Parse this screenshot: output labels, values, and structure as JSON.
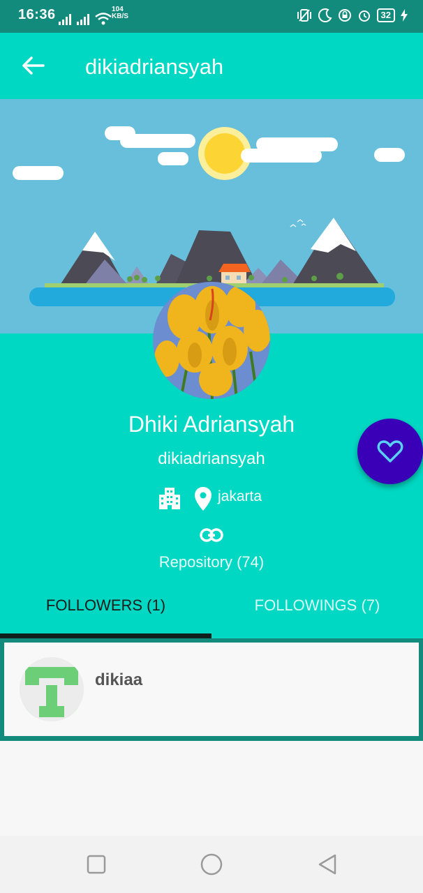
{
  "status_bar": {
    "time": "16:36",
    "network_speed_value": "104",
    "network_speed_unit": "KB/S",
    "battery": "32"
  },
  "app_bar": {
    "back_icon": "arrow-left-icon",
    "title": "dikiadriansyah"
  },
  "profile": {
    "name": "Dhiki Adriansyah",
    "username": "dikiadriansyah",
    "company_icon": "building-icon",
    "location_icon": "map-pin-icon",
    "location": "jakarta",
    "link_icon": "link-icon",
    "repository": "Repository (74)"
  },
  "tabs": [
    {
      "label": "FOLLOWERS (1)",
      "selected": true
    },
    {
      "label": "FOLLOWINGS (7)",
      "selected": false
    }
  ],
  "favorite_button": {
    "icon": "heart-icon"
  },
  "followers": [
    {
      "username": "dikiaa"
    }
  ],
  "colors": {
    "accent": "#00d8c3",
    "status_bar": "#128a7c",
    "fab": "#3a00b8"
  },
  "nav_bar": {
    "icons": [
      "square-icon",
      "circle-icon",
      "triangle-back-icon"
    ]
  }
}
